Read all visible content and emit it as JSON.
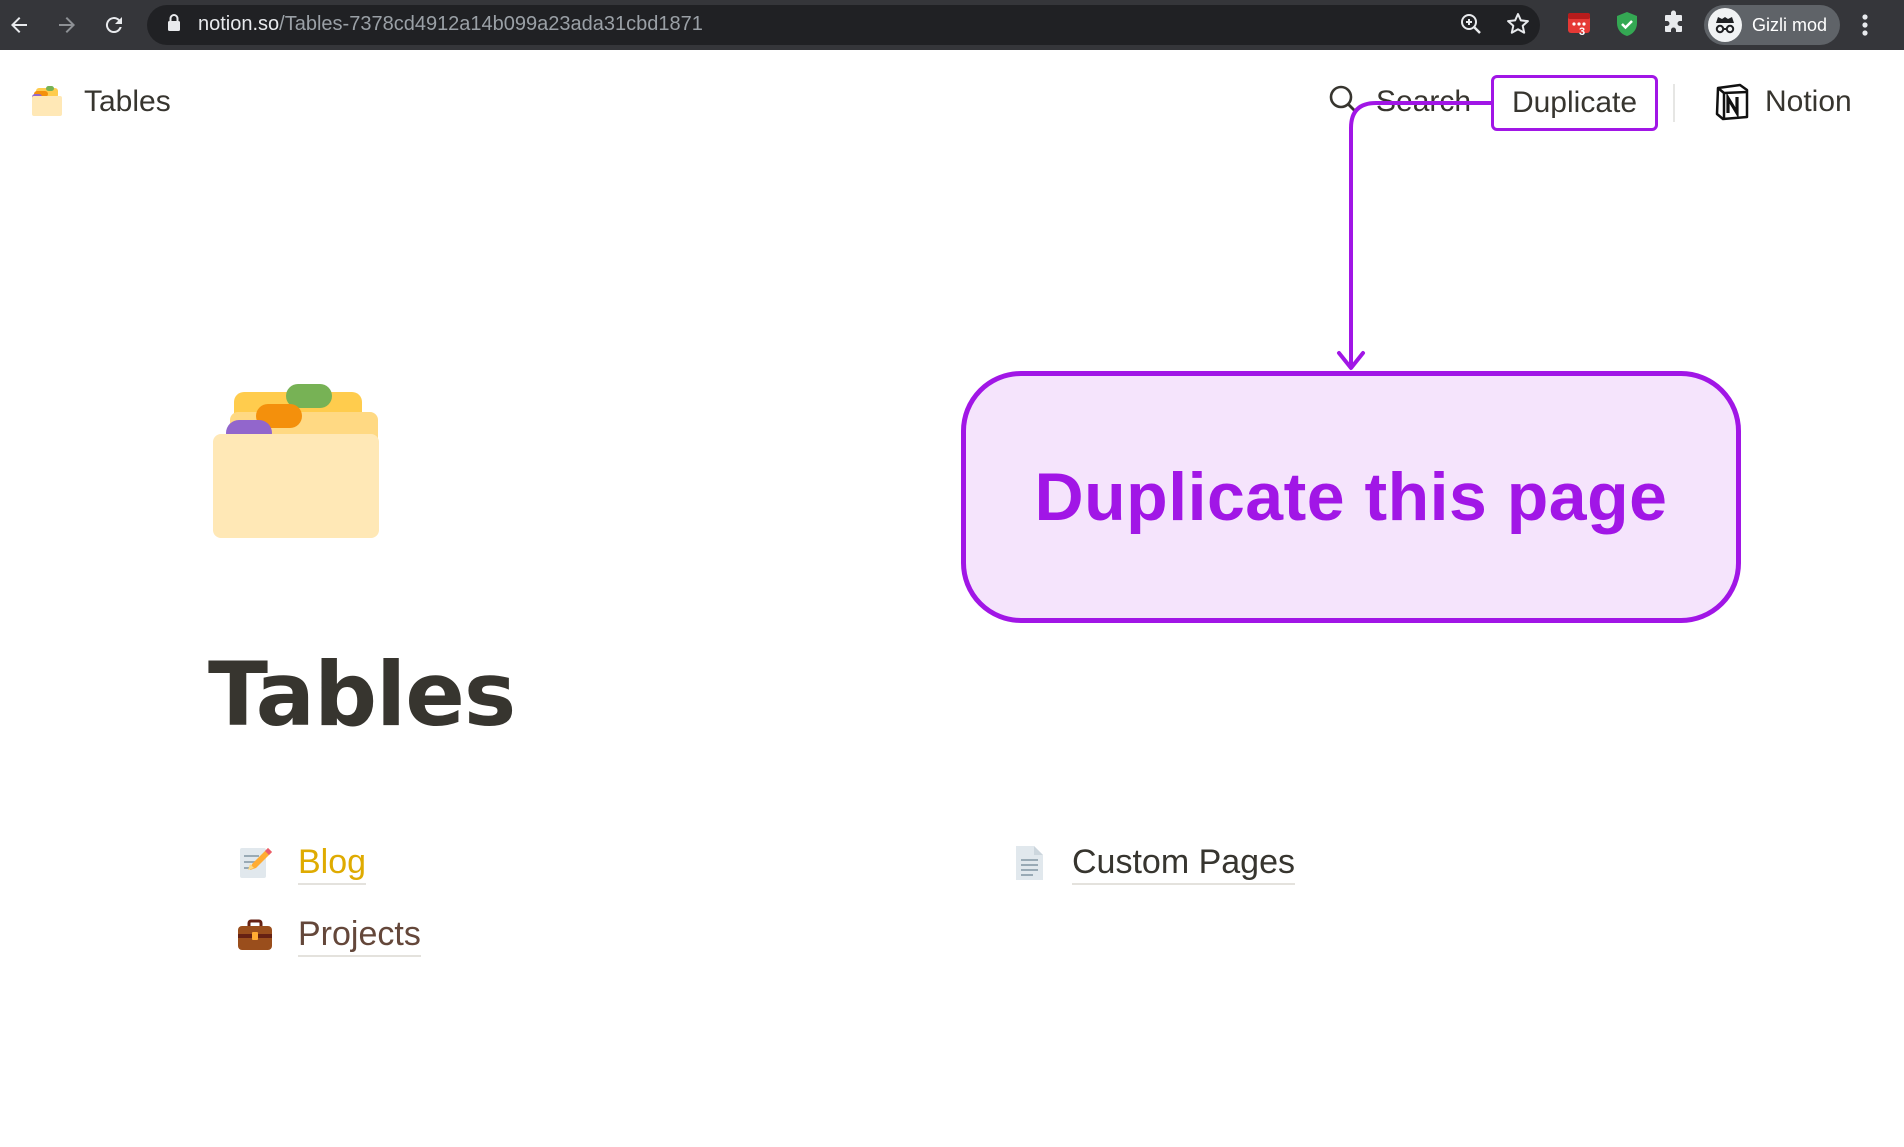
{
  "browser": {
    "url_host": "notion.so",
    "url_path": "/Tables-7378cd4912a14b099a23ada31cbd1871",
    "extension_badge": "3",
    "profile_label": "Gizli mod"
  },
  "topbar": {
    "breadcrumb_label": "Tables",
    "search_label": "Search",
    "duplicate_label": "Duplicate",
    "brand_label": "Notion"
  },
  "page": {
    "title": "Tables",
    "sub_pages": [
      {
        "label": "Blog",
        "icon": "memo-icon"
      },
      {
        "label": "Projects",
        "icon": "briefcase-icon"
      },
      {
        "label": "Custom Pages",
        "icon": "document-icon"
      }
    ]
  },
  "annotation": {
    "callout_text": "Duplicate this page"
  },
  "colors": {
    "accent": "#a116e6",
    "callout_bg": "#f5e4fc",
    "browser_chrome": "#35363a",
    "blog_link": "#dfab01",
    "projects_link": "#64473a",
    "text": "#37352f"
  }
}
